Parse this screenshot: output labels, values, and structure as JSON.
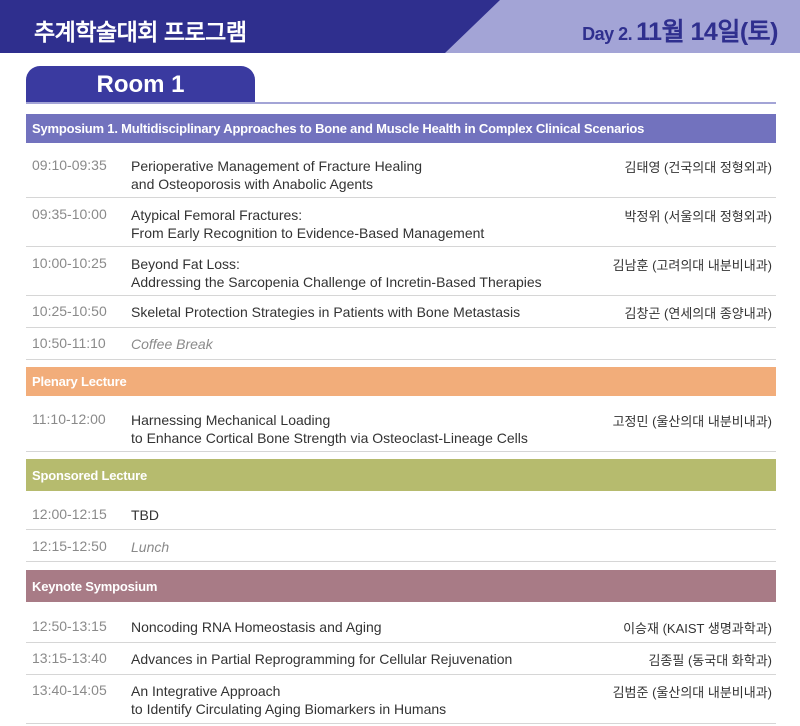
{
  "header": {
    "title": "추계학술대회 프로그램",
    "day_label": "Day 2.",
    "date": "11월 14일(토)"
  },
  "room": {
    "name": "Room 1"
  },
  "colors": {
    "banner_dark": "#2f2f8e",
    "banner_light": "#a3a4d6",
    "symposium_bar": "#7272be",
    "plenary_bar": "#f2ad7a",
    "sponsored_bar": "#b6bb6e",
    "keynote_bar": "#a87b86"
  },
  "sessions": [
    {
      "title": "Symposium 1. Multidisciplinary Approaches to Bone and Muscle Health in Complex Clinical Scenarios",
      "items": [
        {
          "time": "09:10-09:35",
          "title_lines": [
            "Perioperative Management of Fracture Healing",
            "and Osteoporosis with Anabolic Agents"
          ],
          "speaker": "김태영 (건국의대 정형외과)"
        },
        {
          "time": "09:35-10:00",
          "title_lines": [
            "Atypical Femoral Fractures:",
            "From Early Recognition to Evidence-Based Management"
          ],
          "speaker": "박정위 (서울의대 정형외과)"
        },
        {
          "time": "10:00-10:25",
          "title_lines": [
            "Beyond Fat Loss:",
            "Addressing the Sarcopenia Challenge of Incretin-Based Therapies"
          ],
          "speaker": "김남훈 (고려의대 내분비내과)"
        },
        {
          "time": "10:25-10:50",
          "title_lines": [
            "Skeletal Protection Strategies in Patients with Bone Metastasis"
          ],
          "speaker": "김창곤 (연세의대 종양내과)"
        },
        {
          "time": "10:50-11:10",
          "title_lines": [
            "Coffee Break"
          ],
          "speaker": ""
        }
      ]
    },
    {
      "title": "Plenary Lecture",
      "items": [
        {
          "time": "11:10-12:00",
          "title_lines": [
            "Harnessing Mechanical Loading",
            "to Enhance Cortical Bone Strength via Osteoclast-Lineage Cells"
          ],
          "speaker": "고정민 (울산의대 내분비내과)"
        }
      ]
    },
    {
      "title": "Sponsored Lecture",
      "items": [
        {
          "time": "12:00-12:15",
          "title_lines": [
            "TBD"
          ],
          "speaker": ""
        },
        {
          "time": "12:15-12:50",
          "title_lines": [
            "Lunch"
          ],
          "speaker": ""
        }
      ]
    },
    {
      "title": "Keynote Symposium",
      "items": [
        {
          "time": "12:50-13:15",
          "title_lines": [
            "Noncoding RNA Homeostasis and Aging"
          ],
          "speaker": "이승재 (KAIST 생명과학과)"
        },
        {
          "time": "13:15-13:40",
          "title_lines": [
            "Advances in Partial Reprogramming for Cellular Rejuvenation"
          ],
          "speaker": "김종필 (동국대 화학과)"
        },
        {
          "time": "13:40-14:05",
          "title_lines": [
            "An Integrative Approach",
            "to Identify Circulating Aging Biomarkers in Humans"
          ],
          "speaker": "김범준 (울산의대 내분비내과)"
        }
      ]
    }
  ]
}
